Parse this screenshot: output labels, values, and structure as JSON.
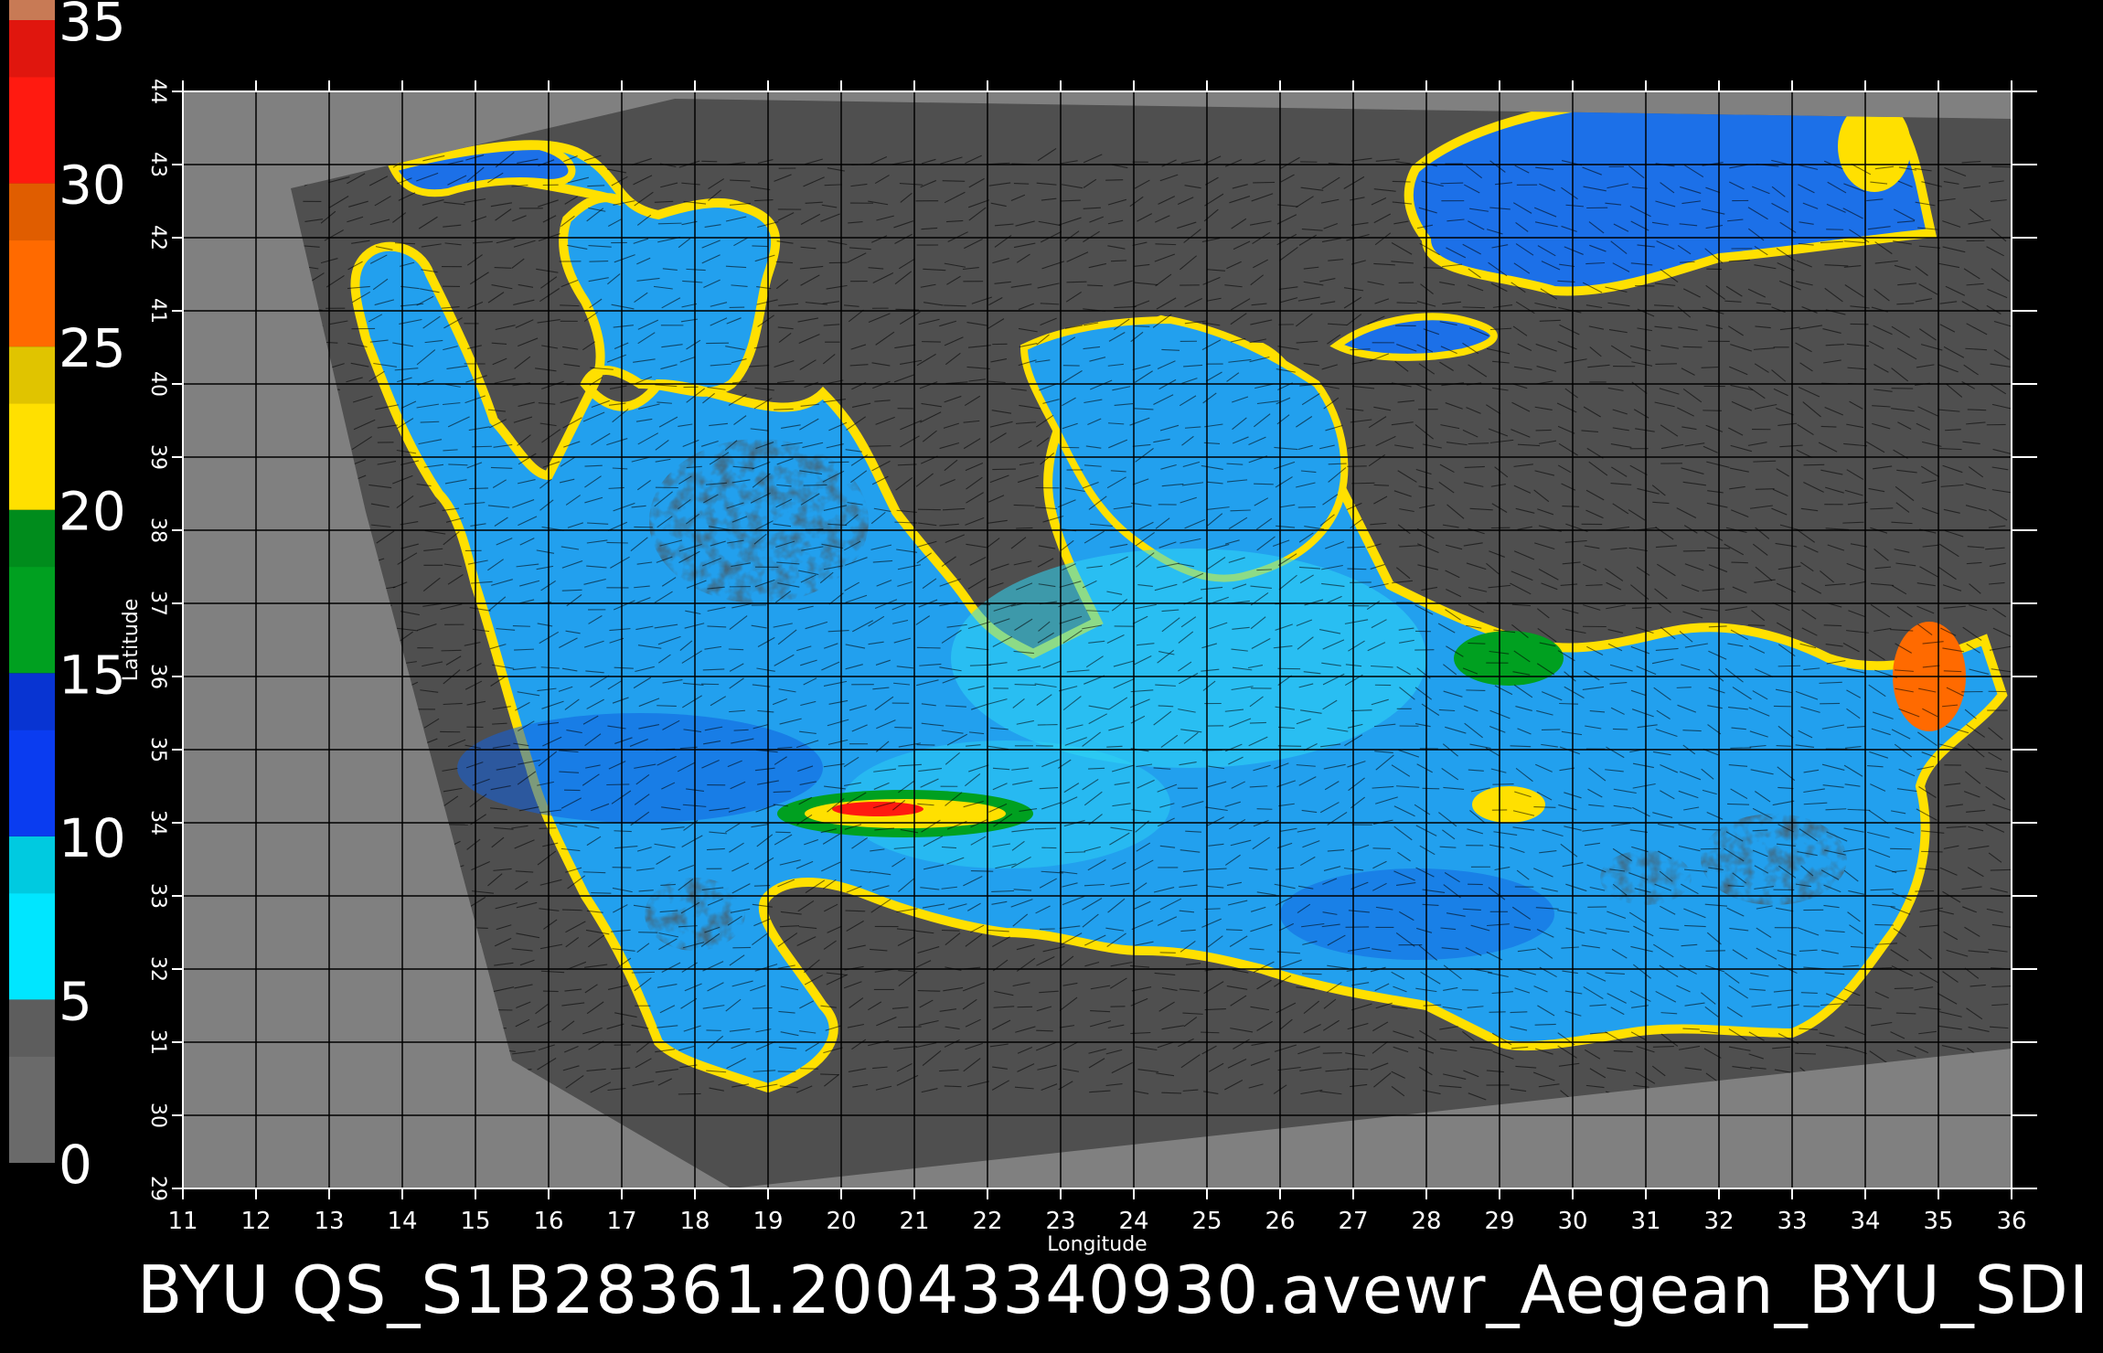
{
  "map": {
    "lon_range": [
      11,
      36
    ],
    "lat_range": [
      29,
      44
    ],
    "lon_ticks": [
      11,
      12,
      13,
      14,
      15,
      16,
      17,
      18,
      19,
      20,
      21,
      22,
      23,
      24,
      25,
      26,
      27,
      28,
      29,
      30,
      31,
      32,
      33,
      34,
      35,
      36
    ],
    "lat_ticks": [
      29,
      30,
      31,
      32,
      33,
      34,
      35,
      36,
      37,
      38,
      39,
      40,
      41,
      42,
      43,
      44
    ],
    "xlabel": "Longitude",
    "ylabel": "Latitude",
    "grid": true,
    "colors": {
      "land": "#4f4f4f",
      "swath_edge": "#5a5a5a",
      "outside_swath": "#808080",
      "sea_base": "#22a0ee",
      "sea_low": "#2fd7f5",
      "sea_mid": "#1060e0",
      "wind_vectors": "#000000"
    },
    "wind_field": "vectors"
  },
  "colorbar": {
    "range": [
      0,
      35
    ],
    "ticks": [
      0,
      5,
      10,
      15,
      20,
      25,
      30,
      35
    ],
    "bands": [
      {
        "from": 0,
        "to": 5,
        "color": "#6a6a6a"
      },
      {
        "from": 5,
        "to": 10,
        "color": "#00e6ff"
      },
      {
        "from": 10,
        "to": 15,
        "color": "#0a3cf0"
      },
      {
        "from": 15,
        "to": 20,
        "color": "#00a020"
      },
      {
        "from": 20,
        "to": 25,
        "color": "#ffe000"
      },
      {
        "from": 25,
        "to": 30,
        "color": "#ff6a00"
      },
      {
        "from": 30,
        "to": 35,
        "color": "#ff1a10"
      }
    ],
    "cap_color": "#c87a55"
  },
  "caption": "BYU  QS_S1B28361.20043340930.avewr_Aegean_BYU_SDI"
}
